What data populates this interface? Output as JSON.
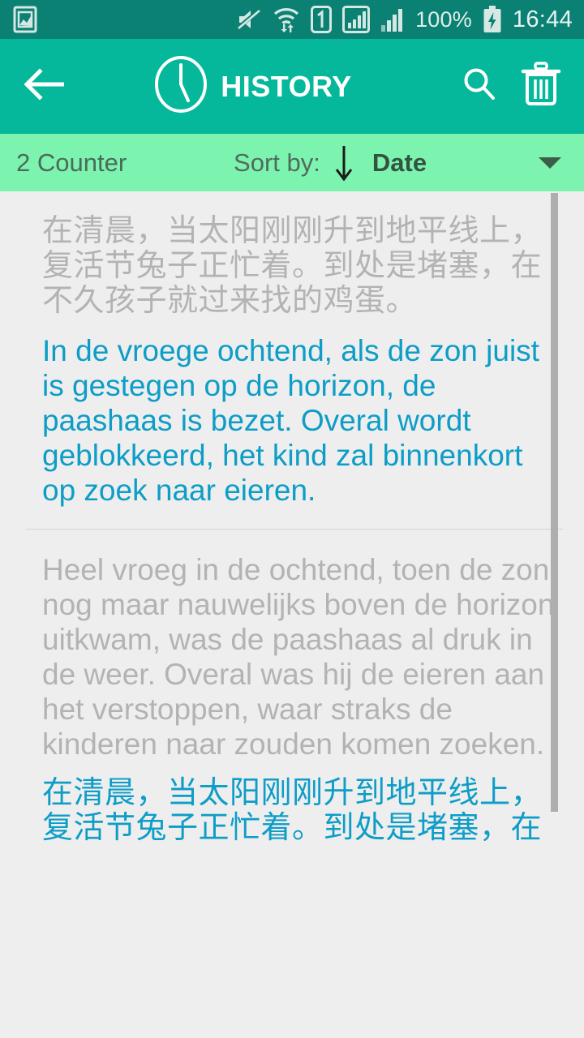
{
  "status_bar": {
    "icons": [
      "photo-icon",
      "mute-icon",
      "wifi-transfer-icon",
      "sim1-icon",
      "signal-strength-icon",
      "signal-strength-2-icon"
    ],
    "battery_percent": "100%",
    "battery_icon": "battery-charging-icon",
    "clock": "16:44",
    "background_color": "#0b8173"
  },
  "app_bar": {
    "back_icon": "arrow-left-icon",
    "clock_icon": "clock-icon",
    "title": "HISTORY",
    "search_icon": "search-icon",
    "delete_icon": "trash-icon",
    "background_color": "#05b89b"
  },
  "sort_bar": {
    "counter": "2 Counter",
    "sort_label": "Sort by:",
    "sort_direction_icon": "arrow-down-icon",
    "sort_value": "Date",
    "dropdown_icon": "caret-down-icon",
    "background_color": "#7df3b0"
  },
  "colors": {
    "source_text": "#b3b3b3",
    "translated_text": "#0d9dc7",
    "list_background": "#eeeeee",
    "divider": "#d2d2d2",
    "scrollbar": "#aeaeae"
  },
  "history": [
    {
      "source": "在清晨，当太阳刚刚升到地平线上，复活节兔子正忙着。到处是堵塞，在不久孩子就过来找的鸡蛋。",
      "translation": "In de vroege ochtend, als de zon juist is gestegen op de horizon, de paashaas is bezet. Overal wordt geblokkeerd, het kind zal binnenkort op zoek naar eieren."
    },
    {
      "source": "Heel vroeg in de ochtend, toen de zon nog maar nauwelijks boven de horizon uitkwam, was de paashaas al druk in de weer. Overal was hij de eieren aan het verstoppen, waar straks de kinderen naar zouden komen zoeken.",
      "translation": "在清晨，当太阳刚刚升到地平线上，复活节兔子正忙着。到处是堵塞，在"
    }
  ]
}
